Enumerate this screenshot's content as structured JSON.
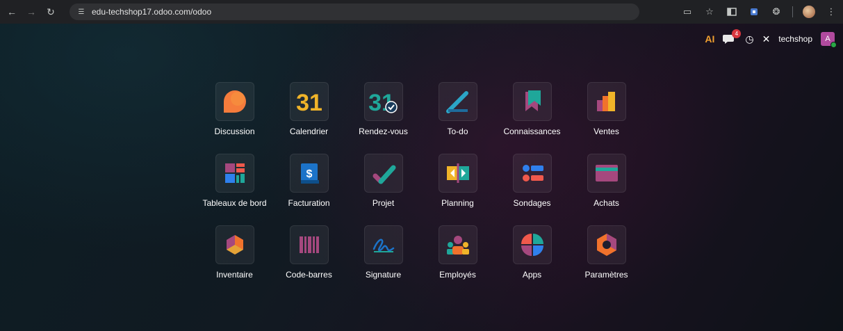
{
  "browser": {
    "url": "edu-techshop17.odoo.com/odoo",
    "back_icon": "arrow-left-icon",
    "forward_icon": "arrow-right-icon",
    "reload_icon": "reload-icon"
  },
  "systray": {
    "ai_label": "AI",
    "chat_badge": "4",
    "company": "techshop",
    "user_initial": "A",
    "colors": {
      "ai": "#f0a030",
      "badge": "#d9363e",
      "avatar": "#b04a9e",
      "online": "#28a745"
    }
  },
  "apps": [
    {
      "label": "Discussion",
      "icon": "discussion-icon"
    },
    {
      "label": "Calendrier",
      "icon": "calendar-icon",
      "glyph": "31"
    },
    {
      "label": "Rendez-vous",
      "icon": "appointment-icon",
      "glyph": "31"
    },
    {
      "label": "To-do",
      "icon": "todo-icon"
    },
    {
      "label": "Connaissances",
      "icon": "knowledge-icon"
    },
    {
      "label": "Ventes",
      "icon": "sales-icon"
    },
    {
      "label": "Tableaux de bord",
      "icon": "dashboard-icon"
    },
    {
      "label": "Facturation",
      "icon": "invoicing-icon",
      "glyph": "$"
    },
    {
      "label": "Projet",
      "icon": "project-icon"
    },
    {
      "label": "Planning",
      "icon": "planning-icon"
    },
    {
      "label": "Sondages",
      "icon": "surveys-icon"
    },
    {
      "label": "Achats",
      "icon": "purchase-icon"
    },
    {
      "label": "Inventaire",
      "icon": "inventory-icon"
    },
    {
      "label": "Code-barres",
      "icon": "barcode-icon"
    },
    {
      "label": "Signature",
      "icon": "signature-icon"
    },
    {
      "label": "Employés",
      "icon": "employees-icon"
    },
    {
      "label": "Apps",
      "icon": "apps-icon"
    },
    {
      "label": "Paramètres",
      "icon": "settings-icon"
    }
  ]
}
